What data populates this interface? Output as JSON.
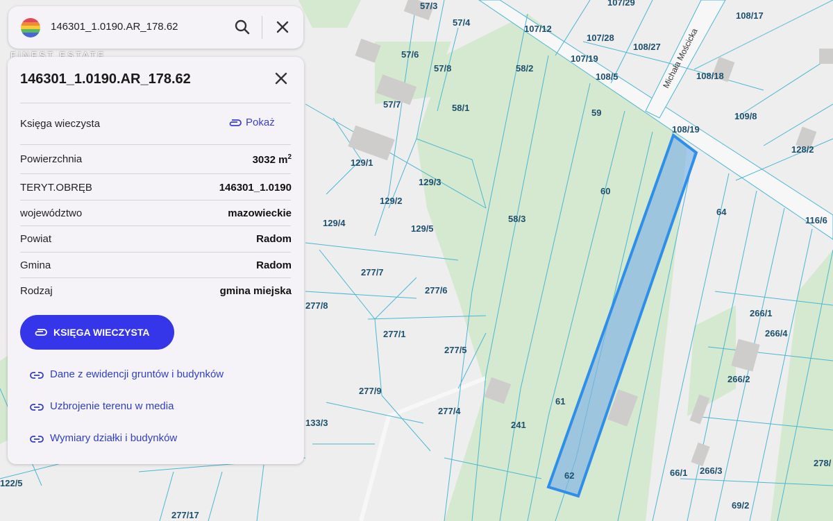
{
  "search": {
    "query": "146301_1.0190.AR_178.62",
    "watermark": "FINEST ESTATE"
  },
  "panel": {
    "title": "146301_1.0190.AR_178.62",
    "rows": [
      {
        "label": "Księga wieczysta",
        "value": "Pokaż"
      },
      {
        "label": "Powierzchnia",
        "value": "3032 m",
        "sup": "2"
      },
      {
        "label": "TERYT.OBRĘB",
        "value": "146301_1.0190"
      },
      {
        "label": "województwo",
        "value": "mazowieckie"
      },
      {
        "label": "Powiat",
        "value": "Radom"
      },
      {
        "label": "Gmina",
        "value": "Radom"
      },
      {
        "label": "Rodzaj",
        "value": "gmina miejska"
      }
    ],
    "primary_button": "KSIĘGA WIECZYSTA",
    "links": [
      "Dane z ewidencji gruntów i budynków",
      "Uzbrojenie terenu w media",
      "Wymiary działki i budynków"
    ]
  },
  "map": {
    "street": "Michała Mościcka",
    "parcels": [
      "57/3",
      "57/4",
      "107/29",
      "108/17",
      "107/12",
      "107/28",
      "108/27",
      "57/6",
      "57/8",
      "107/19",
      "108/5",
      "108/18",
      "58/2",
      "57/7",
      "58/1",
      "59",
      "108/19",
      "109/8",
      "128/2",
      "129/1",
      "129/3",
      "129/2",
      "60",
      "64",
      "116/6",
      "129/4",
      "129/5",
      "58/3",
      "277/7",
      "277/6",
      "277/8",
      "266/1",
      "277/1",
      "266/4",
      "277/5",
      "266/2",
      "277/9",
      "61",
      "277/4",
      "133/3",
      "241",
      "278/",
      "62",
      "66/1",
      "266/3",
      "122/5",
      "69/2",
      "277/17"
    ],
    "highlight_color": "#2f8fe8"
  }
}
